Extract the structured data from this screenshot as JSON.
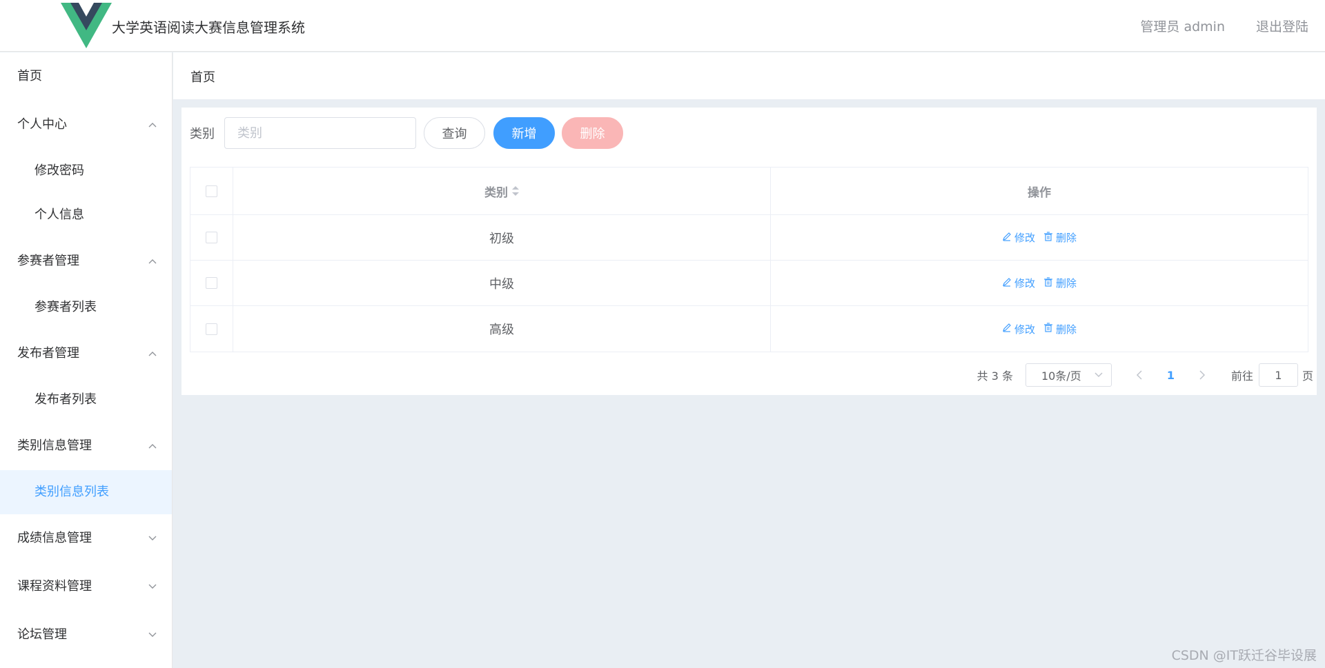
{
  "header": {
    "title": "大学英语阅读大赛信息管理系统",
    "user": "管理员 admin",
    "logout": "退出登陆"
  },
  "sidebar": {
    "items": [
      {
        "label": "首页",
        "type": "top",
        "chevron": ""
      },
      {
        "label": "个人中心",
        "type": "group",
        "chevron": "up"
      },
      {
        "label": "修改密码",
        "type": "sub"
      },
      {
        "label": "个人信息",
        "type": "sub"
      },
      {
        "label": "参赛者管理",
        "type": "group",
        "chevron": "up"
      },
      {
        "label": "参赛者列表",
        "type": "sub"
      },
      {
        "label": "发布者管理",
        "type": "group",
        "chevron": "up"
      },
      {
        "label": "发布者列表",
        "type": "sub"
      },
      {
        "label": "类别信息管理",
        "type": "group",
        "chevron": "up"
      },
      {
        "label": "类别信息列表",
        "type": "sub",
        "active": true
      },
      {
        "label": "成绩信息管理",
        "type": "group",
        "chevron": "down"
      },
      {
        "label": "课程资料管理",
        "type": "group",
        "chevron": "down"
      },
      {
        "label": "论坛管理",
        "type": "group",
        "chevron": "down"
      }
    ]
  },
  "breadcrumb": {
    "current": "首页"
  },
  "search": {
    "label": "类别",
    "placeholder": "类别",
    "query_button": "查询",
    "add_button": "新增",
    "delete_button": "删除"
  },
  "table": {
    "columns": [
      "类别",
      "操作"
    ],
    "rows": [
      {
        "category": "初级"
      },
      {
        "category": "中级"
      },
      {
        "category": "高级"
      }
    ],
    "edit_label": "修改",
    "delete_label": "删除"
  },
  "pagination": {
    "total": "共 3 条",
    "page_size": "10条/页",
    "current_page": "1",
    "goto_label": "前往",
    "goto_value": "1",
    "page_unit": "页"
  },
  "watermark": "CSDN @IT跃迁谷毕设展",
  "colors": {
    "primary": "#409eff",
    "danger_light": "#fab6b6",
    "active_bg": "#ecf5ff",
    "logo_green": "#41b883",
    "logo_dark": "#35495e"
  }
}
